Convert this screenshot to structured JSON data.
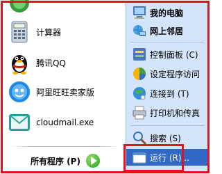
{
  "left_programs": [
    {
      "label": "",
      "icon": "program-icon"
    },
    {
      "label": "计算器",
      "icon": "calculator-icon"
    },
    {
      "label": "腾讯QQ",
      "icon": "qq-penguin-icon"
    },
    {
      "label": "阿里旺旺卖家版",
      "icon": "aliwangwang-icon"
    },
    {
      "label": "cloudmail.exe",
      "icon": "cloudmail-icon"
    }
  ],
  "all_programs": {
    "label": "所有程序 (P)",
    "icon": "green-arrow-icon"
  },
  "right_items": [
    {
      "label": "我的电脑",
      "icon": "my-computer-icon",
      "bold": true
    },
    {
      "label": "网上邻居",
      "icon": "network-places-icon",
      "bold": true
    },
    {
      "label": "控制面板 (C)",
      "icon": "control-panel-icon",
      "bold": false
    },
    {
      "label": "设定程序访问",
      "icon": "program-access-icon",
      "bold": false
    },
    {
      "label": "连接到 (T)",
      "icon": "connect-to-icon",
      "bold": false
    },
    {
      "label": "打印机和传真",
      "icon": "printer-fax-icon",
      "bold": false
    },
    {
      "label": "搜索 (S)",
      "icon": "search-icon",
      "bold": false
    },
    {
      "label": "运行 (R)...",
      "icon": "run-icon",
      "bold": false
    }
  ],
  "colors": {
    "highlight_border": "#e1131b",
    "right_panel": "#d3e5fa",
    "selected": "#3169c6"
  }
}
